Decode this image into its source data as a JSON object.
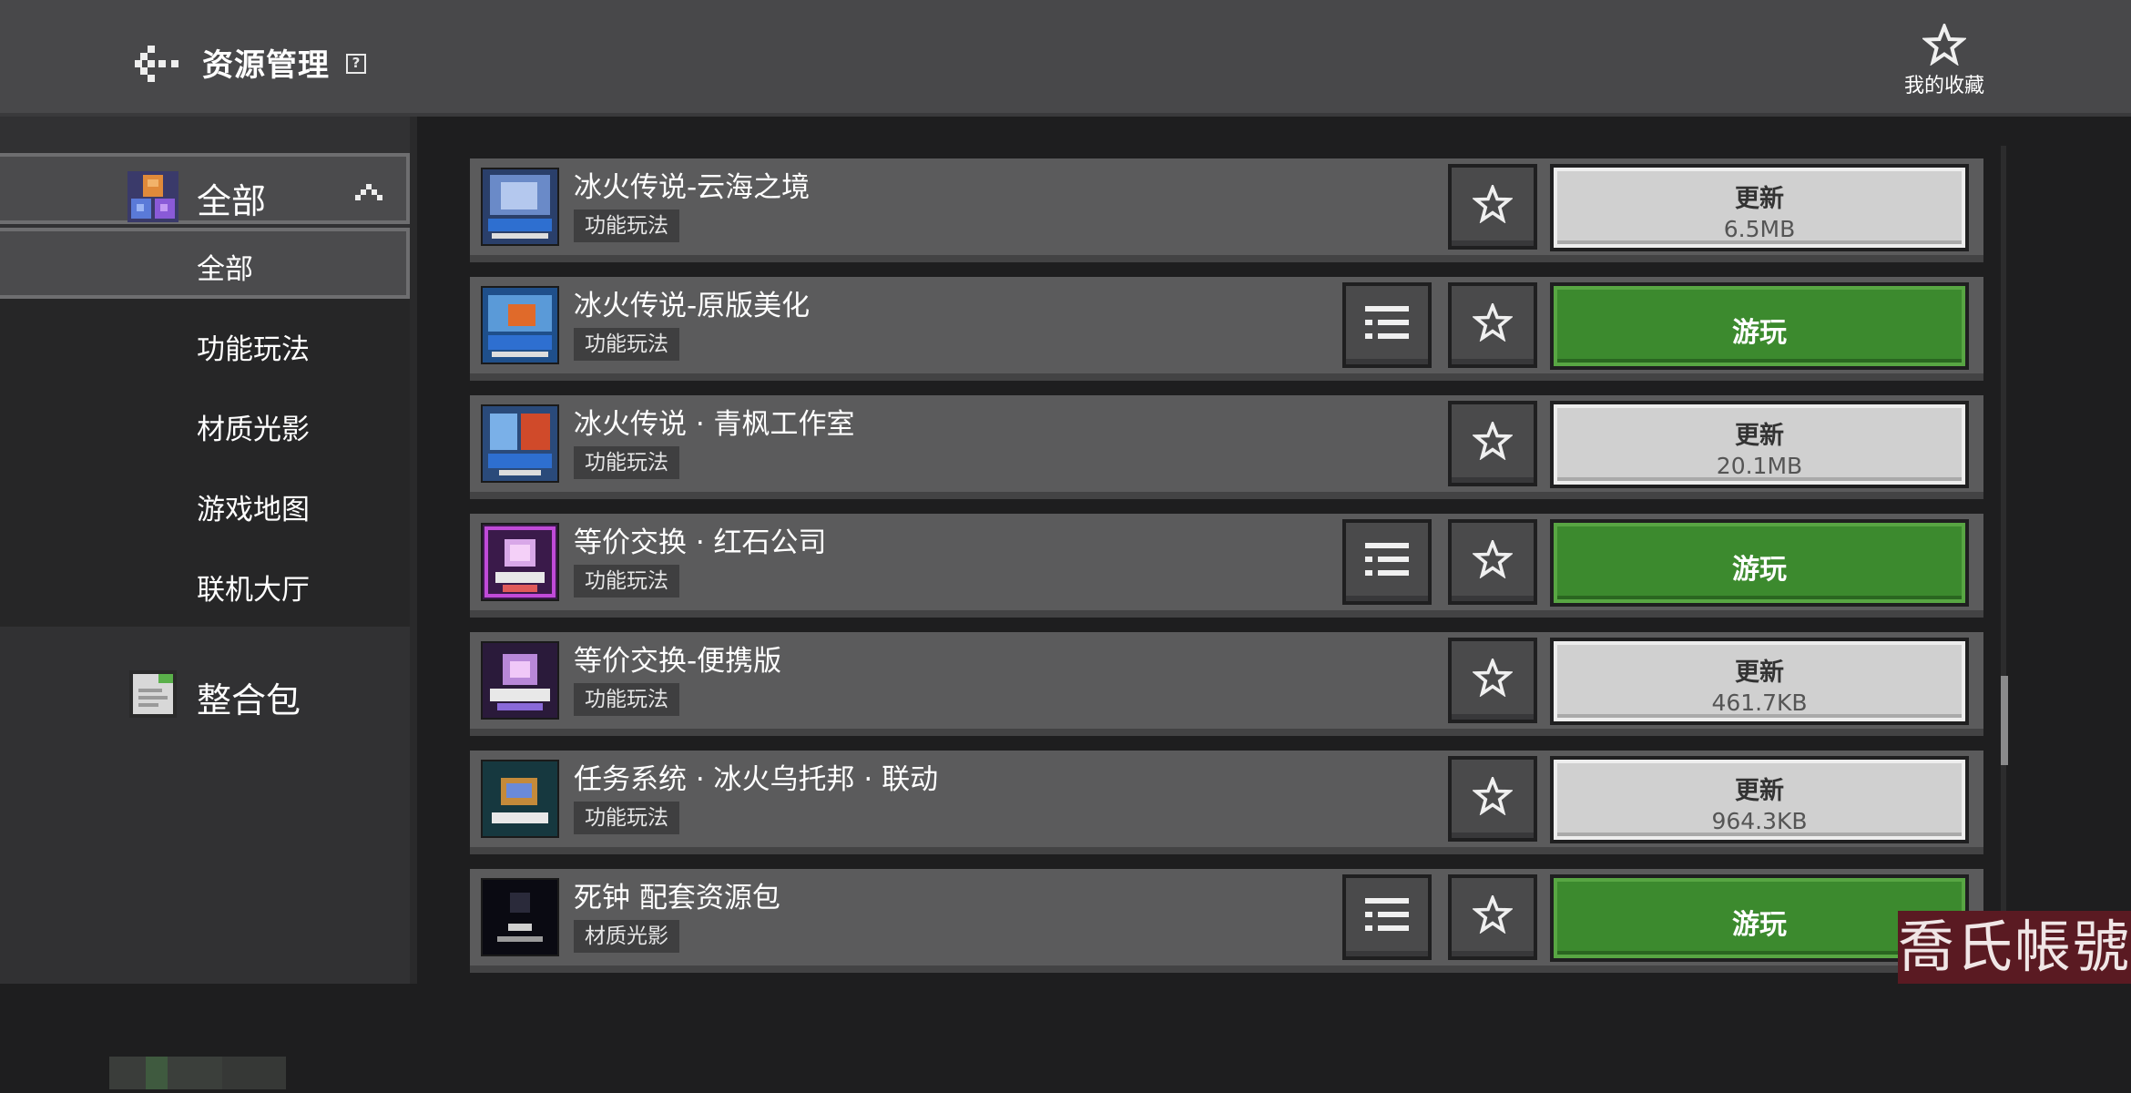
{
  "header": {
    "title": "资源管理",
    "help_glyph": "?",
    "favorites_label": "我的收藏",
    "back_icon": "back-arrow-icon",
    "favorites_icon": "star-icon"
  },
  "sidebar": {
    "category": {
      "label": "全部",
      "icon": "blocks-icon",
      "expanded": true
    },
    "sub_items": [
      {
        "label": "全部",
        "active": true
      },
      {
        "label": "功能玩法",
        "active": false
      },
      {
        "label": "材质光影",
        "active": false
      },
      {
        "label": "游戏地图",
        "active": false
      },
      {
        "label": "联机大厅",
        "active": false
      }
    ],
    "bundle": {
      "label": "整合包",
      "icon": "document-icon"
    }
  },
  "items": [
    {
      "title": "冰火传说-云海之境",
      "tag": "功能玩法",
      "action": "update",
      "action_label": "更新",
      "size": "6.5MB",
      "has_menu": false,
      "thumb_color": "#3a5a8a"
    },
    {
      "title": "冰火传说-原版美化",
      "tag": "功能玩法",
      "action": "play",
      "action_label": "游玩",
      "size": "",
      "has_menu": true,
      "thumb_color": "#2f6aa8"
    },
    {
      "title": "冰火传说 · 青枫工作室",
      "tag": "功能玩法",
      "action": "update",
      "action_label": "更新",
      "size": "20.1MB",
      "has_menu": false,
      "thumb_color": "#2d5c96"
    },
    {
      "title": "等价交换 · 红石公司",
      "tag": "功能玩法",
      "action": "play",
      "action_label": "游玩",
      "size": "",
      "has_menu": true,
      "thumb_color": "#5a2a6a"
    },
    {
      "title": "等价交换-便携版",
      "tag": "功能玩法",
      "action": "update",
      "action_label": "更新",
      "size": "461.7KB",
      "has_menu": false,
      "thumb_color": "#4a2a5a"
    },
    {
      "title": "任务系统 · 冰火乌托邦 · 联动",
      "tag": "功能玩法",
      "action": "update",
      "action_label": "更新",
      "size": "964.3KB",
      "has_menu": false,
      "thumb_color": "#1e4a55"
    },
    {
      "title": "死钟 配套资源包",
      "tag": "材质光影",
      "action": "play",
      "action_label": "游玩",
      "size": "",
      "has_menu": true,
      "thumb_color": "#0c0c14"
    }
  ],
  "watermark": "喬氏帳號",
  "colors": {
    "play": "#3c8a2e",
    "update": "#d0d0d0",
    "row": "#5b5b5c"
  }
}
